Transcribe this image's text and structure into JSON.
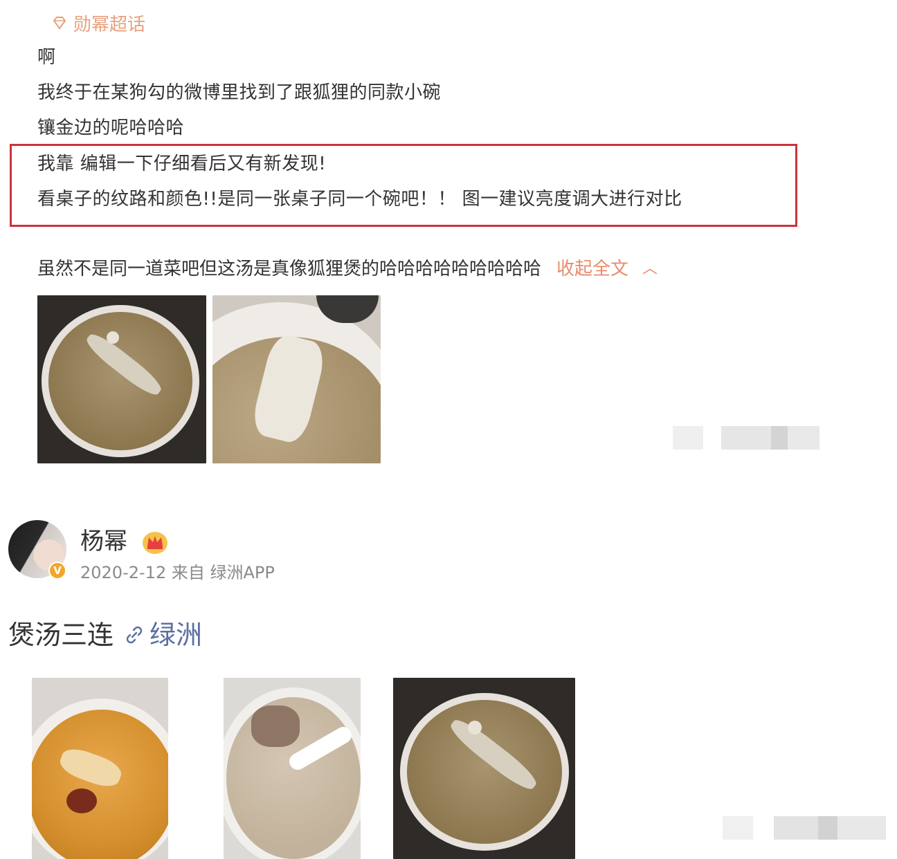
{
  "topic": {
    "label": "勋幂超话",
    "icon": "diamond-icon",
    "color": "#e8a17e"
  },
  "post1": {
    "lines": [
      "啊",
      "我终于在某狗勾的微博里找到了跟狐狸的同款小碗",
      "镶金边的呢哈哈哈",
      "我靠 编辑一下仔细看后又有新发现!",
      "看桌子的纹路和颜色!!是同一张桌子同一个碗吧！！ 图一建议亮度调大进行对比"
    ],
    "last_line": "虽然不是同一道菜吧但这汤是真像狐狸煲的哈哈哈哈哈哈哈哈哈",
    "collapse_label": "收起全文",
    "collapse_icon": "chevron-up-icon",
    "highlight_color": "#c8343b"
  },
  "post2": {
    "author": "杨幂",
    "meta": "2020-2-12 来自 绿洲APP",
    "verified_badge": "V",
    "text": "煲汤三连",
    "link_label": "绿洲",
    "link_icon": "link-icon"
  }
}
